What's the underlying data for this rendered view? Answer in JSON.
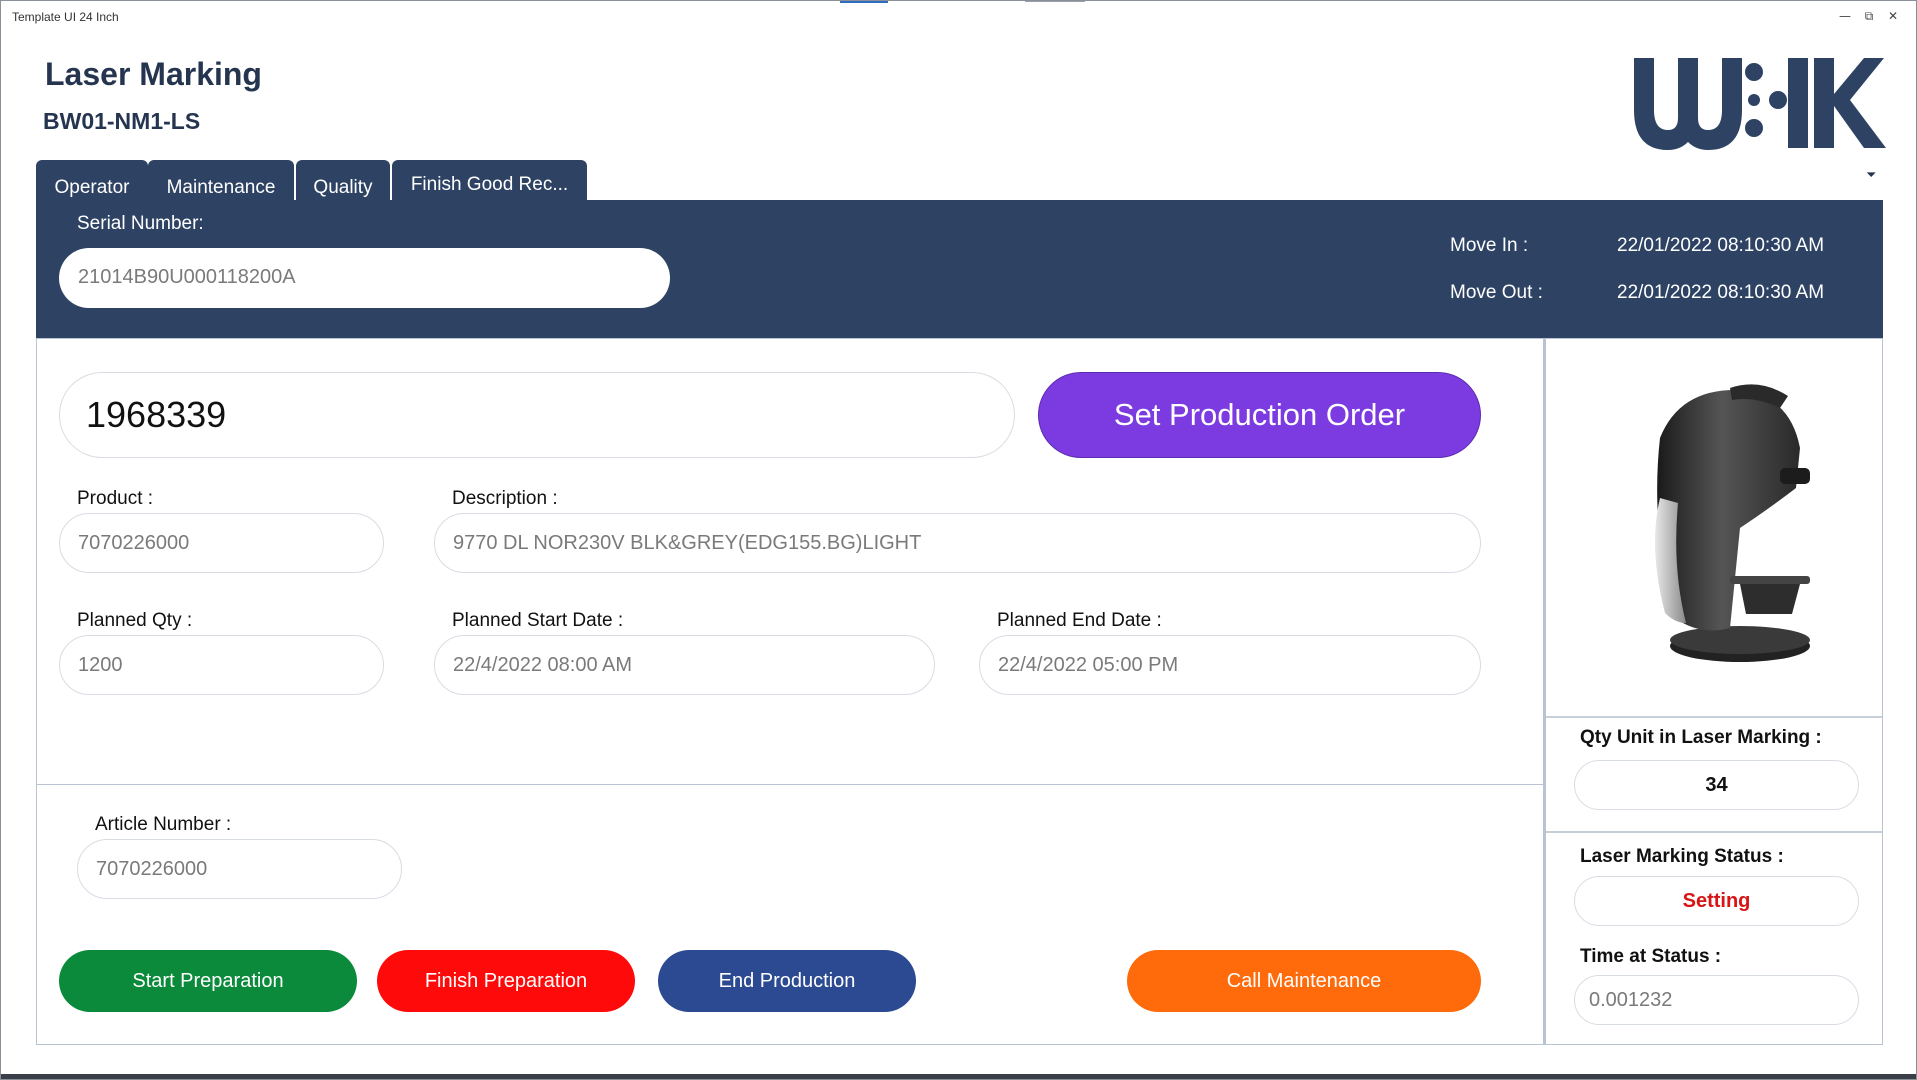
{
  "window": {
    "title": "Template UI 24 Inch",
    "controls": {
      "minimize": "▭",
      "maximize": "⧉",
      "close": "✕"
    }
  },
  "header": {
    "app_title": "Laser Marking",
    "station": "BW01-NM1-LS",
    "logo_alt": "WIK logo"
  },
  "tabs": [
    {
      "label": "Operator"
    },
    {
      "label": "Maintenance"
    },
    {
      "label": "Quality"
    },
    {
      "label": "Finish Good Rec..."
    }
  ],
  "band": {
    "serial_label": "Serial Number:",
    "serial_value": "21014B90U000118200A",
    "move_in_label": "Move In :",
    "move_in_value": "22/01/2022 08:10:30 AM",
    "move_out_label": "Move Out :",
    "move_out_value": "22/01/2022 08:10:30 AM"
  },
  "order": {
    "number": "1968339",
    "set_button": "Set Production Order"
  },
  "fields": {
    "product_label": "Product :",
    "product_value": "7070226000",
    "description_label": "Description :",
    "description_value": "9770 DL NOR230V BLK&GREY(EDG155.BG)LIGHT",
    "planned_qty_label": "Planned Qty :",
    "planned_qty_value": "1200",
    "planned_start_label": "Planned Start Date :",
    "planned_start_value": "22/4/2022 08:00 AM",
    "planned_end_label": "Planned End Date :",
    "planned_end_value": "22/4/2022 05:00 PM",
    "article_label": "Article Number :",
    "article_value": "7070226000"
  },
  "actions": {
    "start_preparation": "Start Preparation",
    "finish_preparation": "Finish Preparation",
    "end_production": "End Production",
    "call_maintenance": "Call Maintenance"
  },
  "side": {
    "qty_label": "Qty Unit in Laser Marking :",
    "qty_value": "34",
    "status_label": "Laser Marking Status :",
    "status_value": "Setting",
    "time_label": "Time at Status :",
    "time_value": "0.001232"
  },
  "colors": {
    "navy": "#2e4263",
    "purple": "#7b3be0",
    "green": "#0a8a3a",
    "red": "#ff0a0a",
    "blue": "#2b4a92",
    "orange": "#ff6a0a",
    "status_red": "#d81414"
  }
}
